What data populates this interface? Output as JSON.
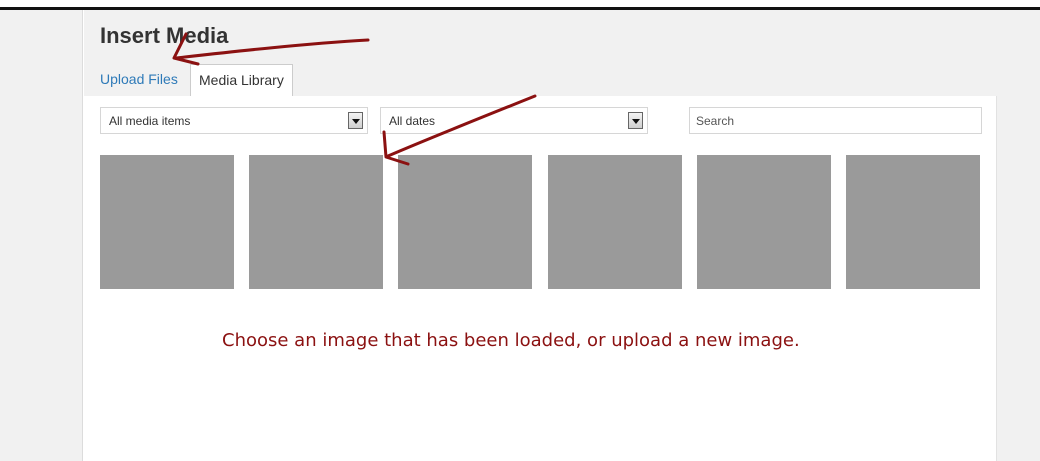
{
  "dialog": {
    "title": "Insert Media"
  },
  "tabs": [
    {
      "label": "Upload Files",
      "active": false
    },
    {
      "label": "Media Library",
      "active": true
    }
  ],
  "filters": {
    "type_select": {
      "value": "All media items"
    },
    "date_select": {
      "value": "All dates"
    },
    "search": {
      "placeholder": "Search",
      "value": ""
    }
  },
  "thumbnails": [
    {},
    {},
    {},
    {},
    {},
    {}
  ],
  "annotation": {
    "note": "Choose an image that has been loaded, or upload a new image.",
    "color": "#8b1111"
  },
  "colors": {
    "link": "#2e7ab8",
    "thumbnail": "#9a9a9a",
    "panel": "#f1f1f1"
  }
}
